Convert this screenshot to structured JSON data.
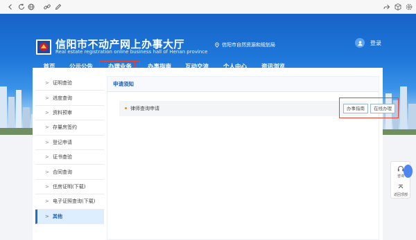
{
  "browser": {
    "icons": [
      "back-icon",
      "refresh-icon",
      "globe-icon",
      "link-icon",
      "edit-icon",
      "share-icon",
      "box-icon",
      "settings-icon"
    ]
  },
  "header": {
    "title_cn": "信阳市不动产网上办事大厅",
    "title_en": "Real estate registration online business hall of Henan province",
    "location": "信阳市自然资源和规划局",
    "login": "登录"
  },
  "nav": {
    "items": [
      {
        "label": "首页"
      },
      {
        "label": "公示公告"
      },
      {
        "label": "办理业务"
      },
      {
        "label": "办事指南"
      },
      {
        "label": "互动交流"
      },
      {
        "label": "个人中心"
      },
      {
        "label": "资讯浏览"
      }
    ],
    "active_index": 2
  },
  "sidebar": {
    "items": [
      {
        "label": "证明查验"
      },
      {
        "label": "进度查询"
      },
      {
        "label": "资料预审"
      },
      {
        "label": "存量房签约"
      },
      {
        "label": "登记申请"
      },
      {
        "label": "证书查验"
      },
      {
        "label": "合同查询"
      },
      {
        "label": "住房证明(下载)"
      },
      {
        "label": "电子证照查询(下载)"
      },
      {
        "label": "其他"
      }
    ],
    "active_index": 9
  },
  "main": {
    "title": "申请须知",
    "row_label": "律师查询申请",
    "btn_guide": "办事指南",
    "btn_apply": "在线办理"
  },
  "float_widget": {
    "consult": "咨询",
    "top": "返回顶部"
  },
  "colors": {
    "brand_blue": "#1763c8",
    "highlight_red": "#e8412e",
    "active_text": "#1c5db6"
  }
}
